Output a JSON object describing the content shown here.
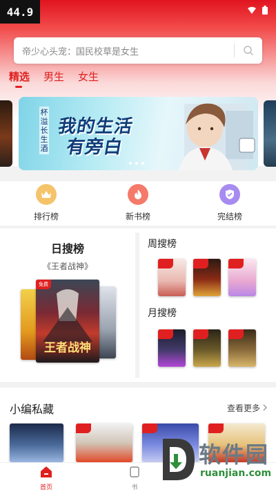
{
  "status_bar": {
    "time": "44.9"
  },
  "search": {
    "placeholder": "帝少心头宠：国民校草是女生"
  },
  "tabs": [
    {
      "label": "精选",
      "active": true
    },
    {
      "label": "男生",
      "active": false
    },
    {
      "label": "女生",
      "active": false
    }
  ],
  "banner": {
    "title_line1": "我的生活",
    "title_line2": "有旁白",
    "vertical_text": "杯溢长生酒",
    "dots": 3
  },
  "quick_links": [
    {
      "label": "排行榜",
      "icon": "crown-icon",
      "color": "#f5c36a"
    },
    {
      "label": "新书榜",
      "icon": "flame-icon",
      "color": "#f47a6a"
    },
    {
      "label": "完结榜",
      "icon": "check-badge-icon",
      "color": "#a78bf0"
    }
  ],
  "daily_rank": {
    "title": "日搜榜",
    "book_title": "《王者战神》",
    "cover_text": "王者战神",
    "tag": "免费"
  },
  "weekly_rank": {
    "title": "周搜榜"
  },
  "monthly_rank": {
    "title": "月搜榜"
  },
  "editor_picks": {
    "title": "小编私藏",
    "more": "查看更多"
  },
  "bottom_nav": [
    {
      "label": "首页",
      "active": true,
      "icon": "home-icon"
    },
    {
      "label": "书",
      "active": false,
      "icon": "book-icon"
    }
  ],
  "watermark": {
    "text": "软件园",
    "domain": "ruanjian.com"
  },
  "colors": {
    "accent": "#e02020"
  }
}
